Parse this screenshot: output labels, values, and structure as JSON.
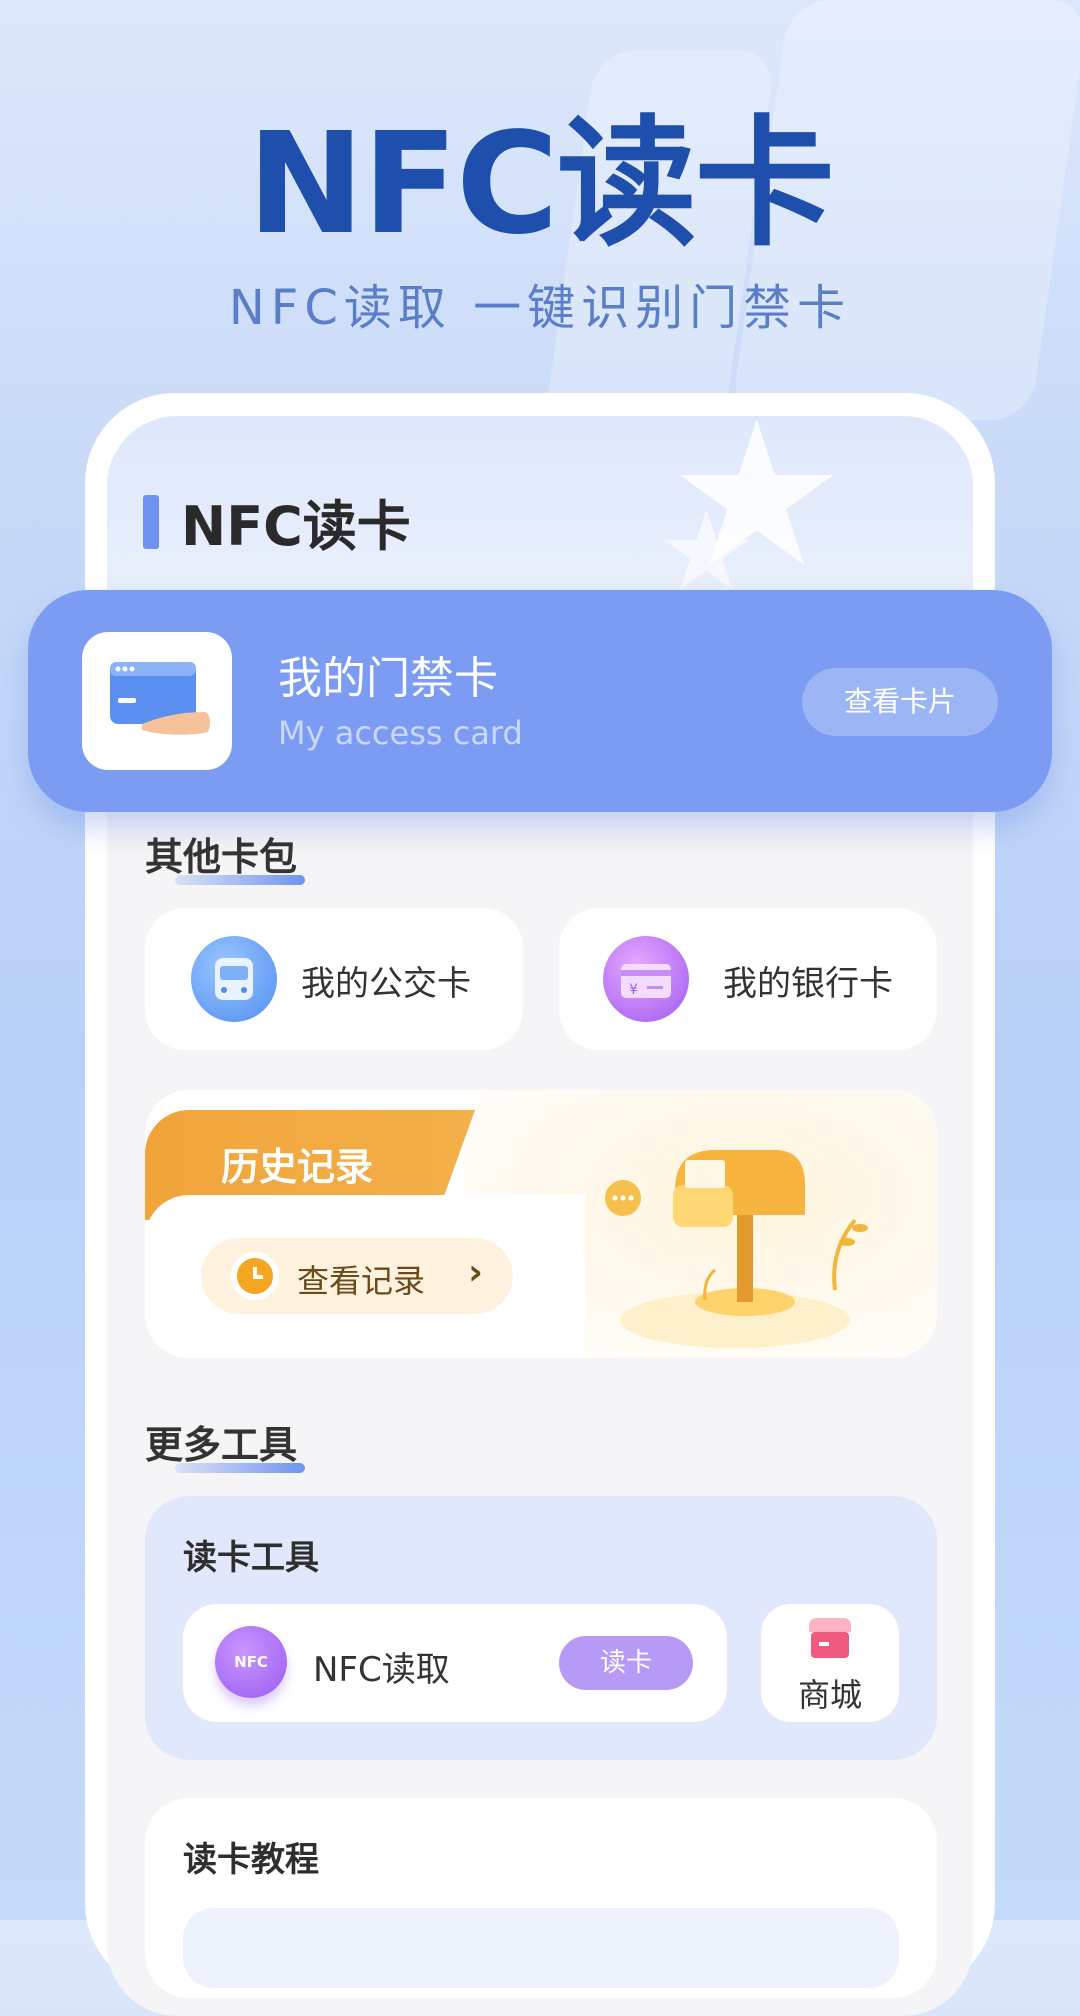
{
  "hero": {
    "title": "NFC读卡",
    "subtitle": "NFC读取 一键识别门禁卡"
  },
  "screen": {
    "section_title": "NFC读卡",
    "access_card": {
      "title": "我的门禁卡",
      "subtitle": "My access card",
      "button": "查看卡片"
    },
    "other_wallets": {
      "title": "其他卡包",
      "items": [
        {
          "label": "我的公交卡",
          "icon": "bus-icon"
        },
        {
          "label": "我的银行卡",
          "icon": "bank-card-icon"
        }
      ]
    },
    "history": {
      "title": "历史记录",
      "button": "查看记录",
      "icon": "clock-icon"
    },
    "more_tools": {
      "title": "更多工具",
      "reader_tools": {
        "title": "读卡工具",
        "nfc_badge": "NFC",
        "nfc_label": "NFC读取",
        "nfc_button": "读卡",
        "shop_label": "商城"
      }
    },
    "tutorial": {
      "title": "读卡教程"
    }
  },
  "colors": {
    "brand_blue": "#1e4fad",
    "card_blue": "#7b9cf2",
    "history_orange": "#f0a43a",
    "nfc_purple": "#b79af5"
  }
}
